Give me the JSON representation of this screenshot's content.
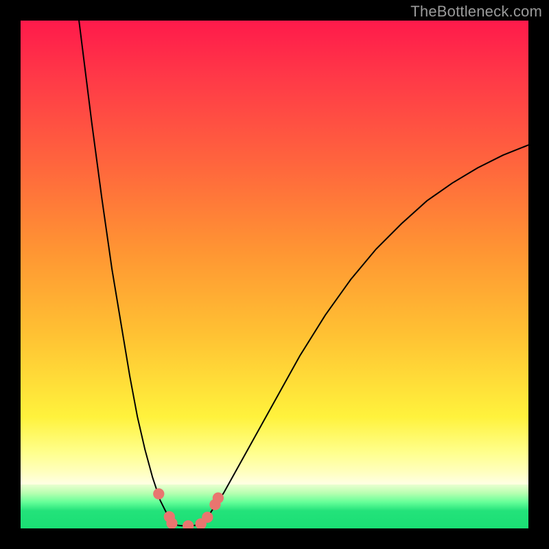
{
  "watermark": "TheBottleneck.com",
  "chart_data": {
    "type": "line",
    "title": "",
    "xlabel": "",
    "ylabel": "",
    "xlim": [
      0,
      100
    ],
    "ylim": [
      0,
      100
    ],
    "grid": false,
    "legend": false,
    "background": {
      "orientation": "vertical",
      "stops": [
        {
          "pos": 0,
          "color": "#ff1a4b"
        },
        {
          "pos": 30,
          "color": "#ff6a3c"
        },
        {
          "pos": 62,
          "color": "#ffc233"
        },
        {
          "pos": 85,
          "color": "#ffff8c"
        },
        {
          "pos": 92,
          "color": "#eaffd0"
        },
        {
          "pos": 100,
          "color": "#1adf74"
        }
      ]
    },
    "series": [
      {
        "name": "left-branch",
        "x": [
          11.5,
          14,
          16,
          18,
          20,
          21.5,
          23,
          24.5,
          26,
          27.5,
          29,
          30
        ],
        "y": [
          100,
          80,
          65,
          51,
          39,
          30,
          22,
          15.5,
          10,
          5.5,
          2.5,
          1
        ]
      },
      {
        "name": "valley-floor",
        "x": [
          30,
          31,
          32,
          33,
          34,
          35,
          36
        ],
        "y": [
          1,
          0.6,
          0.5,
          0.5,
          0.55,
          0.7,
          1
        ]
      },
      {
        "name": "right-branch",
        "x": [
          36,
          40,
          45,
          50,
          55,
          60,
          65,
          70,
          75,
          80,
          85,
          90,
          95,
          100
        ],
        "y": [
          1,
          7,
          16,
          25,
          34,
          42,
          49,
          55,
          60,
          64.5,
          68,
          71,
          73.5,
          75.5
        ]
      }
    ],
    "markers": [
      {
        "x": 27.2,
        "y": 6.8,
        "r": 1.1
      },
      {
        "x": 29.3,
        "y": 2.3,
        "r": 1.1
      },
      {
        "x": 29.8,
        "y": 1.0,
        "r": 1.1
      },
      {
        "x": 33.0,
        "y": 0.5,
        "r": 1.1
      },
      {
        "x": 35.5,
        "y": 0.9,
        "r": 1.1
      },
      {
        "x": 36.8,
        "y": 2.2,
        "r": 1.1
      },
      {
        "x": 38.3,
        "y": 4.7,
        "r": 1.1
      },
      {
        "x": 38.9,
        "y": 6.0,
        "r": 1.1
      }
    ]
  }
}
